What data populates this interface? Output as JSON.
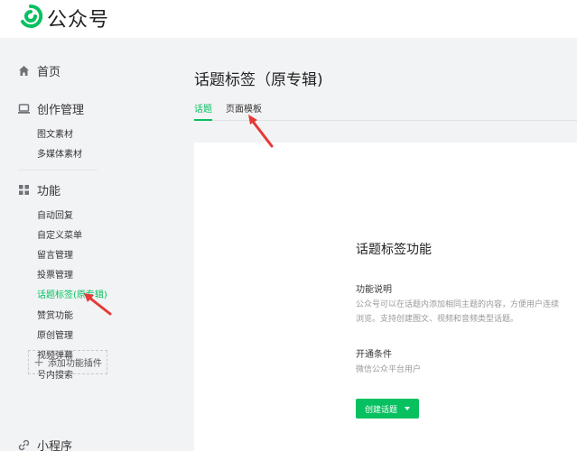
{
  "brand": {
    "name": "公众号",
    "accent": "#07c160"
  },
  "sidebar": {
    "home": {
      "label": "首页",
      "icon": "home-icon"
    },
    "create": {
      "label": "创作管理",
      "icon": "laptop-icon",
      "items": [
        {
          "label": "图文素材"
        },
        {
          "label": "多媒体素材"
        }
      ]
    },
    "features": {
      "label": "功能",
      "icon": "grid-icon",
      "items": [
        {
          "label": "自动回复"
        },
        {
          "label": "自定义菜单"
        },
        {
          "label": "留言管理"
        },
        {
          "label": "投票管理"
        },
        {
          "label": "话题标签(原专辑)",
          "active": true
        },
        {
          "label": "赞赏功能"
        },
        {
          "label": "原创管理"
        },
        {
          "label": "视频弹幕"
        },
        {
          "label": "号内搜索"
        }
      ],
      "add_plugin": "添加功能插件"
    },
    "miniprogram": {
      "label": "小程序",
      "icon": "link-icon"
    }
  },
  "main": {
    "title": "话题标签（原专辑)",
    "tabs": [
      {
        "label": "话题",
        "active": true
      },
      {
        "label": "页面模板",
        "active": false
      }
    ],
    "card": {
      "title": "话题标签功能",
      "description_label": "功能说明",
      "description_lines": [
        "公众号可以在话题内添加相同主题的内容，方便用户连续",
        "浏览。支持创建图文、视频和音频类型话题。"
      ],
      "condition_label": "开通条件",
      "condition_text": "微信公众平台用户",
      "create_button": "创建话题"
    }
  },
  "colors": {
    "annotation": "#e53935",
    "active": "#07c160"
  }
}
